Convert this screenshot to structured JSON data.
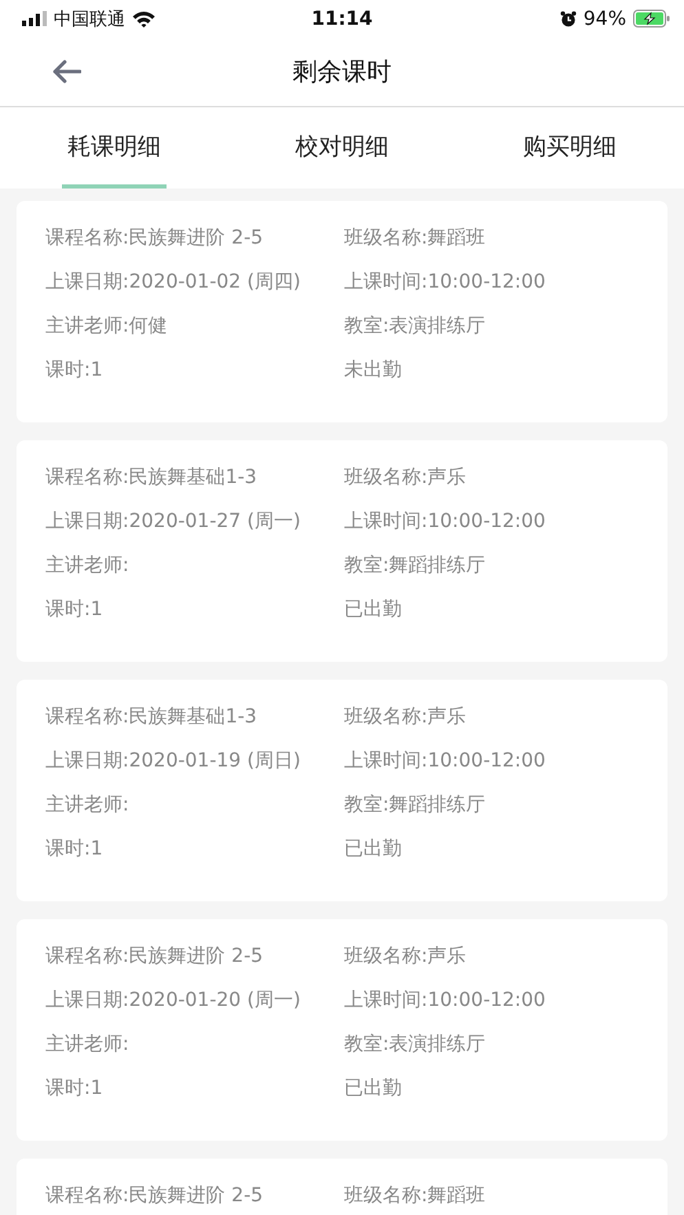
{
  "status_bar": {
    "carrier": "中国联通",
    "time": "11:14",
    "battery": "94%"
  },
  "nav": {
    "title": "剩余课时"
  },
  "tabs": [
    {
      "label": "耗课明细",
      "selected": true
    },
    {
      "label": "校对明细",
      "selected": false
    },
    {
      "label": "购买明细",
      "selected": false
    }
  ],
  "records": [
    {
      "left": [
        "课程名称:民族舞进阶 2-5",
        "上课日期:2020-01-02 (周四)",
        "主讲老师:何健",
        "课时:1"
      ],
      "right": [
        "班级名称:舞蹈班",
        "上课时间:10:00-12:00",
        "教室:表演排练厅",
        "未出勤"
      ]
    },
    {
      "left": [
        "课程名称:民族舞基础1-3",
        "上课日期:2020-01-27 (周一)",
        "主讲老师:",
        "课时:1"
      ],
      "right": [
        "班级名称:声乐",
        "上课时间:10:00-12:00",
        "教室:舞蹈排练厅",
        "已出勤"
      ]
    },
    {
      "left": [
        "课程名称:民族舞基础1-3",
        "上课日期:2020-01-19 (周日)",
        "主讲老师:",
        "课时:1"
      ],
      "right": [
        "班级名称:声乐",
        "上课时间:10:00-12:00",
        "教室:舞蹈排练厅",
        "已出勤"
      ]
    },
    {
      "left": [
        "课程名称:民族舞进阶 2-5",
        "上课日期:2020-01-20 (周一)",
        "主讲老师:",
        "课时:1"
      ],
      "right": [
        "班级名称:声乐",
        "上课时间:10:00-12:00",
        "教室:表演排练厅",
        "已出勤"
      ]
    },
    {
      "left": [
        "课程名称:民族舞进阶 2-5"
      ],
      "right": [
        "班级名称:舞蹈班"
      ]
    }
  ]
}
